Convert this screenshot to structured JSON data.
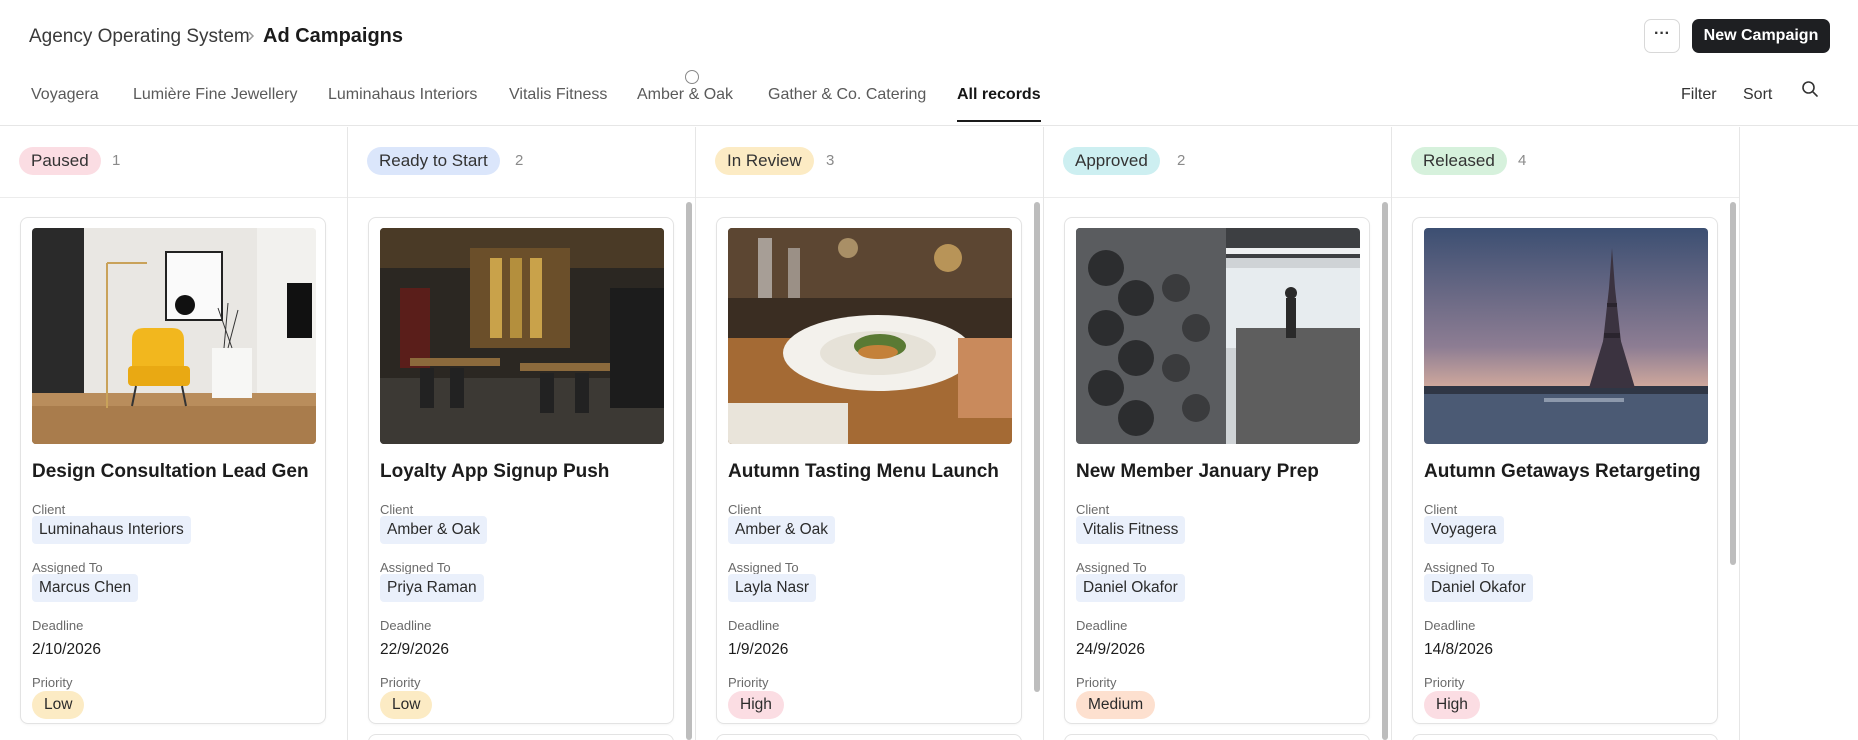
{
  "header": {
    "breadcrumb_root": "Agency Operating System",
    "breadcrumb_current": "Ad Campaigns",
    "more_label": "···",
    "new_button": "New Campaign"
  },
  "tabs": [
    {
      "label": "Voyagera"
    },
    {
      "label": "Lumière Fine Jewellery"
    },
    {
      "label": "Luminahaus Interiors"
    },
    {
      "label": "Vitalis Fitness"
    },
    {
      "label": "Amber & Oak"
    },
    {
      "label": "Gather & Co. Catering"
    },
    {
      "label": "All records"
    }
  ],
  "active_tab": "All records",
  "toolbar": {
    "filter": "Filter",
    "sort": "Sort"
  },
  "field_labels": {
    "client": "Client",
    "assigned": "Assigned To",
    "deadline": "Deadline",
    "priority": "Priority"
  },
  "columns": [
    {
      "status": "Paused",
      "count": "1",
      "color": "#fbdde3"
    },
    {
      "status": "Ready to Start",
      "count": "2",
      "color": "#dbe6fb"
    },
    {
      "status": "In Review",
      "count": "3",
      "color": "#fcebc4"
    },
    {
      "status": "Approved",
      "count": "2",
      "color": "#cdeff1"
    },
    {
      "status": "Released",
      "count": "4",
      "color": "#d6f1dc"
    }
  ],
  "cards": [
    {
      "title": "Design Consultation Lead Gen",
      "client": "Luminahaus Interiors",
      "assigned": "Marcus Chen",
      "deadline": "2/10/2026",
      "priority": "Low",
      "priority_color": "#fcebc4",
      "image": "interior-living-room"
    },
    {
      "title": "Loyalty App Signup Push",
      "client": "Amber & Oak",
      "assigned": "Priya Raman",
      "deadline": "22/9/2026",
      "priority": "Low",
      "priority_color": "#fcebc4",
      "image": "restaurant-dining-room"
    },
    {
      "title": "Autumn Tasting Menu Launch",
      "client": "Amber & Oak",
      "assigned": "Layla Nasr",
      "deadline": "1/9/2026",
      "priority": "High",
      "priority_color": "#fbdde3",
      "image": "plated-dish"
    },
    {
      "title": "New Member January Prep",
      "client": "Vitalis Fitness",
      "assigned": "Daniel Okafor",
      "deadline": "24/9/2026",
      "priority": "Medium",
      "priority_color": "#fde0cf",
      "image": "gym-dumbbells"
    },
    {
      "title": "Autumn Getaways Retargeting",
      "client": "Voyagera",
      "assigned": "Daniel Okafor",
      "deadline": "14/8/2026",
      "priority": "High",
      "priority_color": "#fbdde3",
      "image": "eiffel-tower"
    }
  ]
}
